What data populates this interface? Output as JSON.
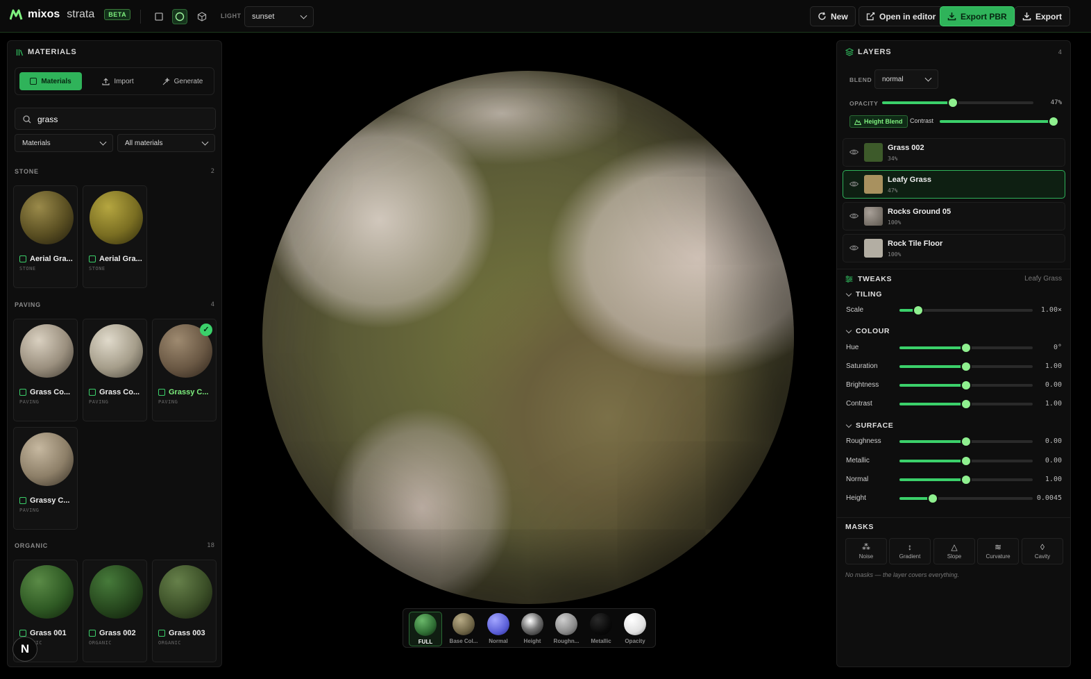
{
  "topbar": {
    "brand": "mixos",
    "brand_sub": "strata",
    "beta": "BETA",
    "light_label": "LIGHT",
    "light_value": "sunset",
    "new_label": "New",
    "open_editor_label": "Open in editor",
    "export_pbr_label": "Export PBR",
    "export_label": "Export",
    "accent_color": "#2fb35a"
  },
  "materials": {
    "title": "MATERIALS",
    "tabs": [
      "Materials",
      "Import",
      "Generate"
    ],
    "search_value": "grass",
    "filter_type": "Materials",
    "filter_scope": "All materials",
    "sections": [
      {
        "name": "STONE",
        "count": "2",
        "items": [
          {
            "name": "Aerial Gra...",
            "cat": "STONE"
          },
          {
            "name": "Aerial Gra...",
            "cat": "STONE"
          }
        ]
      },
      {
        "name": "PAVING",
        "count": "4",
        "items": [
          {
            "name": "Grass Co...",
            "cat": "PAVING"
          },
          {
            "name": "Grass Co...",
            "cat": "PAVING"
          },
          {
            "name": "Grassy C...",
            "cat": "PAVING",
            "selected": true
          },
          {
            "name": "Grassy C...",
            "cat": "PAVING"
          }
        ]
      },
      {
        "name": "ORGANIC",
        "count": "18",
        "items": [
          {
            "name": "Grass 001",
            "cat": "ORGANIC"
          },
          {
            "name": "Grass 002",
            "cat": "ORGANIC"
          },
          {
            "name": "Grass 003",
            "cat": "ORGANIC"
          }
        ]
      }
    ],
    "n_badge": "N"
  },
  "viewbar": {
    "items": [
      "FULL",
      "Base Col...",
      "Normal",
      "Height",
      "Roughn...",
      "Metallic",
      "Opacity"
    ],
    "active": "FULL"
  },
  "layers": {
    "title": "LAYERS",
    "count": "4",
    "blend_label": "BLEND",
    "blend_value": "normal",
    "opacity_label": "OPACITY",
    "opacity_value": "47%",
    "opacity_fraction": 0.47,
    "height_blend_label": "Height Blend",
    "contrast_label": "Contrast",
    "contrast_fraction": 1.0,
    "list": [
      {
        "name": "Grass 002",
        "pct": "34%"
      },
      {
        "name": "Leafy Grass",
        "pct": "47%",
        "selected": true
      },
      {
        "name": "Rocks Ground 05",
        "pct": "100%"
      },
      {
        "name": "Rock Tile Floor",
        "pct": "100%"
      }
    ]
  },
  "tweaks": {
    "title": "TWEAKS",
    "target": "Leafy Grass",
    "tiling": {
      "title": "TILING",
      "rows": [
        {
          "label": "Scale",
          "value": "1.00×",
          "fraction": 0.14
        }
      ]
    },
    "colour": {
      "title": "COLOUR",
      "rows": [
        {
          "label": "Hue",
          "value": "0°",
          "fraction": 0.5
        },
        {
          "label": "Saturation",
          "value": "1.00",
          "fraction": 0.5
        },
        {
          "label": "Brightness",
          "value": "0.00",
          "fraction": 0.5
        },
        {
          "label": "Contrast",
          "value": "1.00",
          "fraction": 0.5
        }
      ]
    },
    "surface": {
      "title": "SURFACE",
      "rows": [
        {
          "label": "Roughness",
          "value": "0.00",
          "fraction": 0.5
        },
        {
          "label": "Metallic",
          "value": "0.00",
          "fraction": 0.5
        },
        {
          "label": "Normal",
          "value": "1.00",
          "fraction": 0.5
        },
        {
          "label": "Height",
          "value": "0.0045",
          "fraction": 0.25
        }
      ]
    }
  },
  "masks": {
    "title": "MASKS",
    "buttons": [
      "Noise",
      "Gradient",
      "Slope",
      "Curvature",
      "Cavity"
    ],
    "note": "No masks — the layer covers everything."
  }
}
